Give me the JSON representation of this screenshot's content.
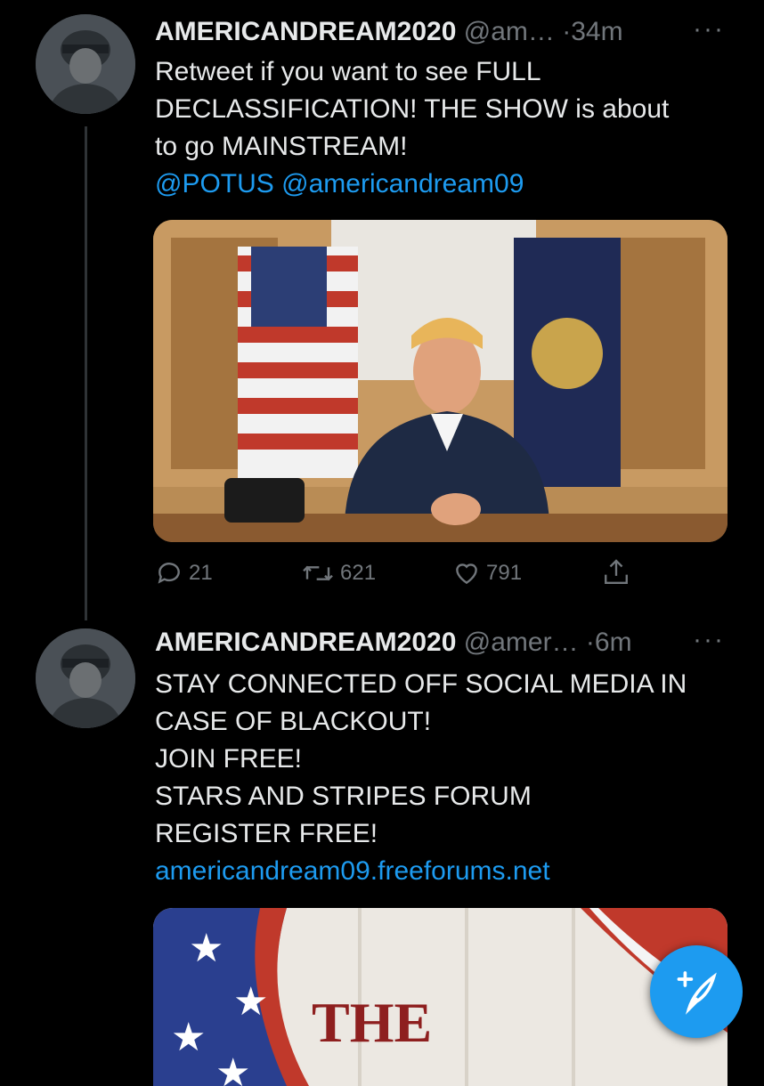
{
  "tweets": [
    {
      "display_name": "AMERICANDREAM2020",
      "handle": "@am…",
      "time": "·34m",
      "lines": [
        "Retweet if you want to see FULL",
        "DECLASSIFICATION! THE SHOW is about",
        "to go MAINSTREAM!"
      ],
      "mentions": "@POTUS @americandream09",
      "replies": "21",
      "retweets": "621",
      "likes": "791"
    },
    {
      "display_name": "AMERICANDREAM2020",
      "handle": "@amer…",
      "time": "·6m",
      "lines": [
        "STAY CONNECTED OFF SOCIAL MEDIA IN",
        "CASE OF BLACKOUT!",
        "JOIN FREE!",
        "STARS AND STRIPES FORUM",
        "REGISTER FREE!"
      ],
      "link": "americandream09.freeforums.net",
      "image_text": "THE"
    }
  ],
  "more_icon": "ellipsis-icon",
  "compose_icon": "compose-feather-icon",
  "colors": {
    "background": "#000000",
    "link": "#1d9bf0",
    "muted": "#71767b"
  }
}
